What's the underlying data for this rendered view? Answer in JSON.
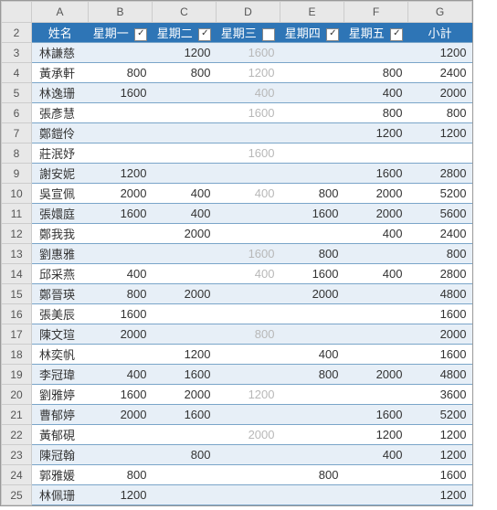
{
  "cols": [
    "A",
    "B",
    "C",
    "D",
    "E",
    "F",
    "G"
  ],
  "rownums": [
    2,
    3,
    4,
    5,
    6,
    7,
    8,
    9,
    10,
    11,
    12,
    13,
    14,
    15,
    16,
    17,
    18,
    19,
    20,
    21,
    22,
    23,
    24,
    25
  ],
  "header": {
    "name": "姓名",
    "days": [
      {
        "label": "星期一",
        "chk": true
      },
      {
        "label": "星期二",
        "chk": true
      },
      {
        "label": "星期三",
        "chk": false
      },
      {
        "label": "星期四",
        "chk": true
      },
      {
        "label": "星期五",
        "chk": true
      }
    ],
    "total": "小計"
  },
  "rows": [
    {
      "name": "林謙慈",
      "d": [
        "",
        "1200",
        "1600",
        "",
        ""
      ],
      "t": "1200"
    },
    {
      "name": "黃承軒",
      "d": [
        "800",
        "800",
        "1200",
        "",
        "800"
      ],
      "t": "2400"
    },
    {
      "name": "林逸珊",
      "d": [
        "1600",
        "",
        "400",
        "",
        "400"
      ],
      "t": "2000"
    },
    {
      "name": "張彥慧",
      "d": [
        "",
        "",
        "1600",
        "",
        "800"
      ],
      "t": "800"
    },
    {
      "name": "鄭鎧伶",
      "d": [
        "",
        "",
        "",
        "",
        "1200"
      ],
      "t": "1200"
    },
    {
      "name": "莊泯妤",
      "d": [
        "",
        "",
        "1600",
        "",
        ""
      ],
      "t": ""
    },
    {
      "name": "謝安妮",
      "d": [
        "1200",
        "",
        "",
        "",
        "1600"
      ],
      "t": "2800"
    },
    {
      "name": "吳宣佩",
      "d": [
        "2000",
        "400",
        "400",
        "800",
        "2000"
      ],
      "t": "5200"
    },
    {
      "name": "張嬛庭",
      "d": [
        "1600",
        "400",
        "",
        "1600",
        "2000"
      ],
      "t": "5600"
    },
    {
      "name": "鄭我我",
      "d": [
        "",
        "2000",
        "",
        "",
        "400"
      ],
      "t": "2400"
    },
    {
      "name": "劉惠雅",
      "d": [
        "",
        "",
        "1600",
        "800",
        ""
      ],
      "t": "800"
    },
    {
      "name": "邱采燕",
      "d": [
        "400",
        "",
        "400",
        "1600",
        "400"
      ],
      "t": "2800"
    },
    {
      "name": "鄭晉瑛",
      "d": [
        "800",
        "2000",
        "",
        "2000",
        ""
      ],
      "t": "4800"
    },
    {
      "name": "張美辰",
      "d": [
        "1600",
        "",
        "",
        "",
        ""
      ],
      "t": "1600"
    },
    {
      "name": "陳文瑄",
      "d": [
        "2000",
        "",
        "800",
        "",
        ""
      ],
      "t": "2000"
    },
    {
      "name": "林奕帆",
      "d": [
        "",
        "1200",
        "",
        "400",
        ""
      ],
      "t": "1600"
    },
    {
      "name": "李冠瑋",
      "d": [
        "400",
        "1600",
        "",
        "800",
        "2000"
      ],
      "t": "4800"
    },
    {
      "name": "劉雅婷",
      "d": [
        "1600",
        "2000",
        "1200",
        "",
        ""
      ],
      "t": "3600"
    },
    {
      "name": "曹郁婷",
      "d": [
        "2000",
        "1600",
        "",
        "",
        "1600"
      ],
      "t": "5200"
    },
    {
      "name": "黃郁硯",
      "d": [
        "",
        "",
        "2000",
        "",
        "1200"
      ],
      "t": "1200"
    },
    {
      "name": "陳冠翰",
      "d": [
        "",
        "800",
        "",
        "",
        "400"
      ],
      "t": "1200"
    },
    {
      "name": "郭雅媛",
      "d": [
        "800",
        "",
        "",
        "800",
        ""
      ],
      "t": "1600"
    },
    {
      "name": "林佩珊",
      "d": [
        "1200",
        "",
        "",
        "",
        ""
      ],
      "t": "1200"
    }
  ]
}
